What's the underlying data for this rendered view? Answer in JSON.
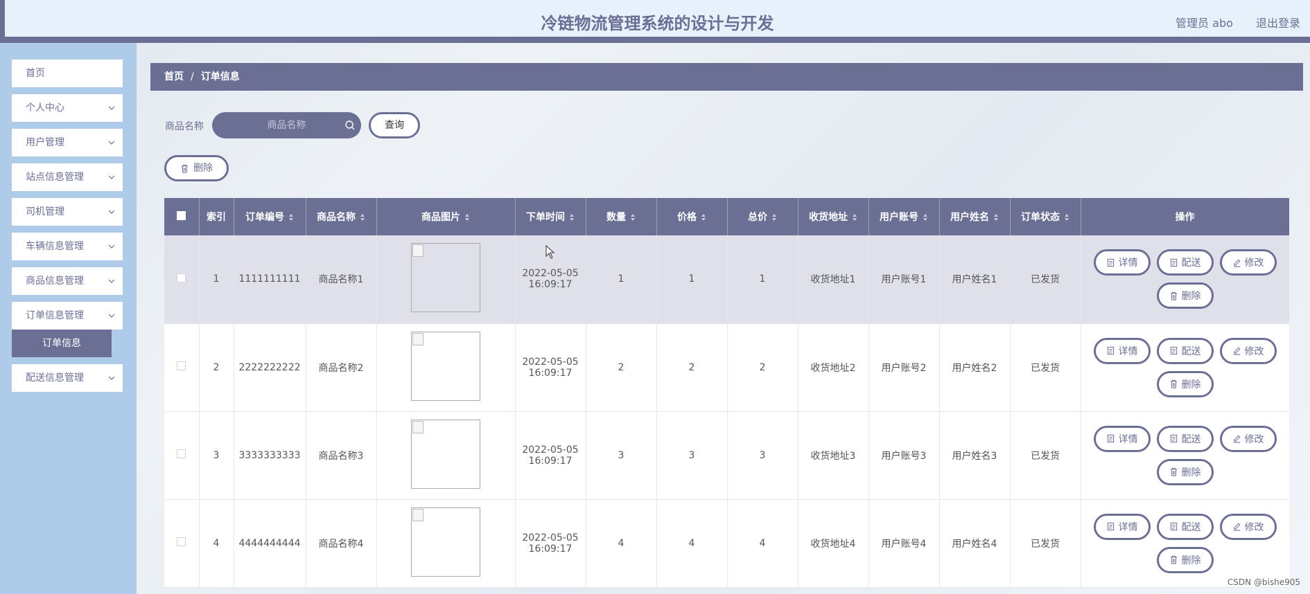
{
  "header": {
    "title": "冷链物流管理系统的设计与开发",
    "user": "管理员 abo",
    "logout": "退出登录"
  },
  "sidebar": {
    "items": [
      {
        "label": "首页",
        "has_chevron": false
      },
      {
        "label": "个人中心",
        "has_chevron": true
      },
      {
        "label": "用户管理",
        "has_chevron": true
      },
      {
        "label": "站点信息管理",
        "has_chevron": true
      },
      {
        "label": "司机管理",
        "has_chevron": true
      },
      {
        "label": "车辆信息管理",
        "has_chevron": true
      },
      {
        "label": "商品信息管理",
        "has_chevron": true
      },
      {
        "label": "订单信息管理",
        "has_chevron": true
      },
      {
        "label": "配送信息管理",
        "has_chevron": true
      }
    ],
    "active_sub": "订单信息"
  },
  "breadcrumb": {
    "home": "首页",
    "current": "订单信息"
  },
  "search": {
    "label": "商品名称",
    "placeholder": "商品名称",
    "button": "查询"
  },
  "toolbar": {
    "delete_label": "删除"
  },
  "table": {
    "headers": [
      "索引",
      "订单编号",
      "商品名称",
      "商品图片",
      "下单时间",
      "数量",
      "价格",
      "总价",
      "收货地址",
      "用户账号",
      "用户姓名",
      "订单状态",
      "操作"
    ],
    "rows": [
      {
        "index": "1",
        "order_no": "1111111111",
        "product": "商品名称1",
        "date": "2022-05-05",
        "time": "16:09:17",
        "qty": "1",
        "price": "1",
        "total": "1",
        "address": "收货地址1",
        "account": "用户账号1",
        "name": "用户姓名1",
        "status": "已发货"
      },
      {
        "index": "2",
        "order_no": "2222222222",
        "product": "商品名称2",
        "date": "2022-05-05",
        "time": "16:09:17",
        "qty": "2",
        "price": "2",
        "total": "2",
        "address": "收货地址2",
        "account": "用户账号2",
        "name": "用户姓名2",
        "status": "已发货"
      },
      {
        "index": "3",
        "order_no": "3333333333",
        "product": "商品名称3",
        "date": "2022-05-05",
        "time": "16:09:17",
        "qty": "3",
        "price": "3",
        "total": "3",
        "address": "收货地址3",
        "account": "用户账号3",
        "name": "用户姓名3",
        "status": "已发货"
      },
      {
        "index": "4",
        "order_no": "4444444444",
        "product": "商品名称4",
        "date": "2022-05-05",
        "time": "16:09:17",
        "qty": "4",
        "price": "4",
        "total": "4",
        "address": "收货地址4",
        "account": "用户账号4",
        "name": "用户姓名4",
        "status": "已发货"
      }
    ],
    "actions": {
      "detail": "详情",
      "dispatch": "配送",
      "edit": "修改",
      "delete": "删除"
    }
  },
  "watermark": "CSDN @bishe905",
  "colors": {
    "primary": "#6b6f94",
    "sidebar_bg": "#aecbea",
    "header_bg": "#e6f1fb"
  }
}
